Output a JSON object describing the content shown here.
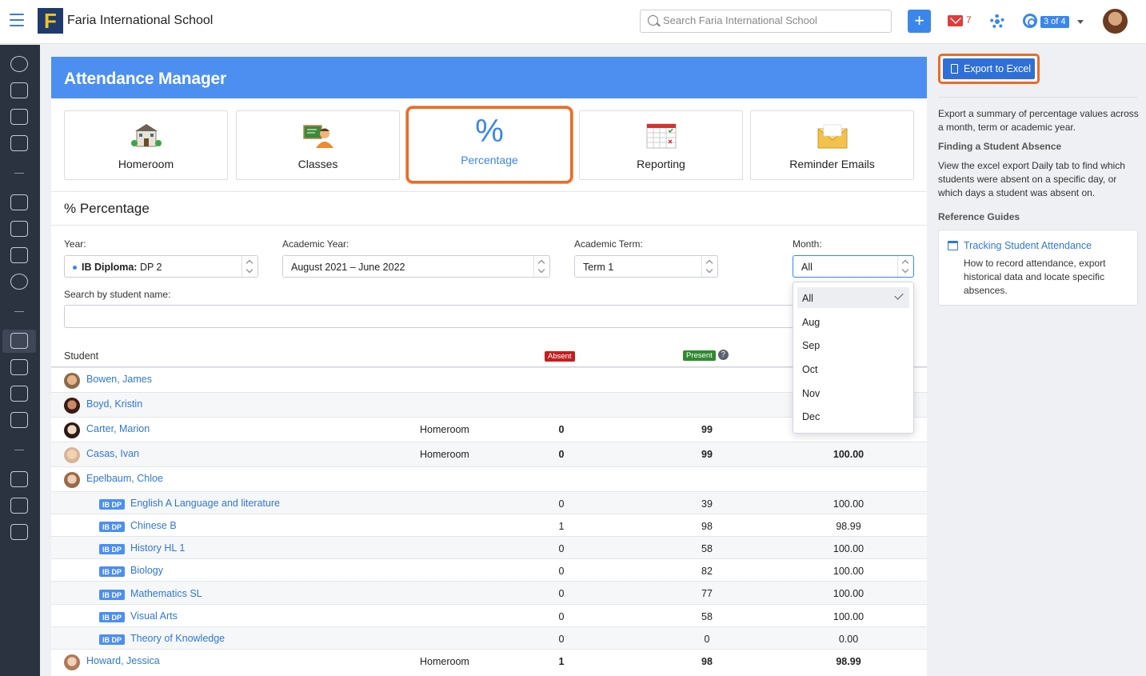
{
  "topbar": {
    "school_name": "Faria International School",
    "logo_letter": "F",
    "search_placeholder": "Search Faria International School",
    "plus_label": "+",
    "mail_count": "7",
    "pager": "3 of 4"
  },
  "page": {
    "title": "Attendance Manager",
    "section_title": "% Percentage"
  },
  "tiles": [
    {
      "label": "Homeroom",
      "icon": "homeroom-icon"
    },
    {
      "label": "Classes",
      "icon": "classes-icon"
    },
    {
      "label": "Percentage",
      "icon": "percentage-icon",
      "glyph": "%"
    },
    {
      "label": "Reporting",
      "icon": "reporting-icon"
    },
    {
      "label": "Reminder Emails",
      "icon": "reminder-emails-icon"
    }
  ],
  "filters": {
    "year_label": "Year:",
    "year_prefix": "IB Diploma:",
    "year_value": "DP 2",
    "academic_year_label": "Academic Year:",
    "academic_year_value": "August 2021 – June 2022",
    "term_label": "Academic Term:",
    "term_value": "Term 1",
    "month_label": "Month:",
    "month_value": "All",
    "search_label": "Search by student name:"
  },
  "month_options": [
    "All",
    "Aug",
    "Sep",
    "Oct",
    "Nov",
    "Dec"
  ],
  "table": {
    "col_student": "Student",
    "col_absent": "Absent",
    "col_present": "Present",
    "help_glyph": "?"
  },
  "students": [
    {
      "name": "Bowen, James"
    },
    {
      "name": "Boyd, Kristin"
    },
    {
      "name": "Carter, Marion",
      "type": "Homeroom",
      "absent": "0",
      "present": "99"
    },
    {
      "name": "Casas, Ivan",
      "type": "Homeroom",
      "absent": "0",
      "present": "99",
      "percent": "100.00"
    },
    {
      "name": "Epelbaum, Chloe"
    },
    {
      "name": "Howard, Jessica",
      "type": "Homeroom",
      "absent": "1",
      "present": "98",
      "percent": "98.99"
    }
  ],
  "subjects": [
    {
      "tag": "IB DP",
      "name": "English A Language and literature",
      "absent": "0",
      "present": "39",
      "percent": "100.00"
    },
    {
      "tag": "IB DP",
      "name": "Chinese B",
      "absent": "1",
      "present": "98",
      "percent": "98.99"
    },
    {
      "tag": "IB DP",
      "name": "History HL 1",
      "absent": "0",
      "present": "58",
      "percent": "100.00"
    },
    {
      "tag": "IB DP",
      "name": "Biology",
      "absent": "0",
      "present": "82",
      "percent": "100.00"
    },
    {
      "tag": "IB DP",
      "name": "Mathematics SL",
      "absent": "0",
      "present": "77",
      "percent": "100.00"
    },
    {
      "tag": "IB DP",
      "name": "Visual Arts",
      "absent": "0",
      "present": "58",
      "percent": "100.00"
    },
    {
      "tag": "IB DP",
      "name": "Theory of Knowledge",
      "absent": "0",
      "present": "0",
      "percent": "0.00"
    }
  ],
  "sidebar": {
    "export_label": "Export to Excel",
    "export_desc": "Export a summary of percentage values across a month, term or academic year.",
    "finding_title": "Finding a Student Absence",
    "finding_desc": "View the excel export Daily tab to find which students were absent on a specific day, or which days a student was absent on.",
    "guides_title": "Reference Guides",
    "guide_link": "Tracking Student Attendance",
    "guide_desc": "How to record attendance, export historical data and locate specific absences."
  },
  "colors": {
    "accent": "#3b86ea",
    "header": "#4c8ff0",
    "highlight": "#ee6a24",
    "absent": "#c21f1f",
    "present": "#2f8a2f",
    "nav_bg": "#2b3240"
  }
}
